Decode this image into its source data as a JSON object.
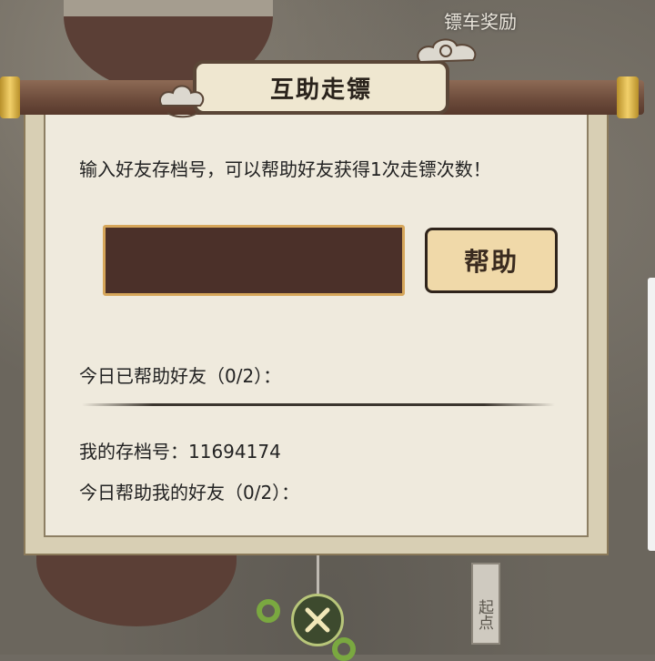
{
  "background": {
    "reward_title": "镖车奖励",
    "start_marker": "起点"
  },
  "dialog": {
    "title": "互助走镖",
    "description": "输入好友存档号，可以帮助好友获得1次走镖次数！",
    "input": {
      "value": "",
      "placeholder": ""
    },
    "help_button_label": "帮助",
    "helped_today_label": "今日已帮助好友（0/2）：",
    "my_code_label": "我的存档号：11694174",
    "helped_me_label": "今日帮助我的好友（0/2）："
  },
  "icons": {
    "close": "close-icon",
    "cloud": "cloud-ornament-icon"
  },
  "colors": {
    "panel_bg": "#efeadd",
    "input_bg": "#4b3029",
    "input_border": "#d6a65a",
    "button_bg": "#f0d9a9",
    "rod": "#6b4a3a",
    "gold": "#f2d06a"
  }
}
